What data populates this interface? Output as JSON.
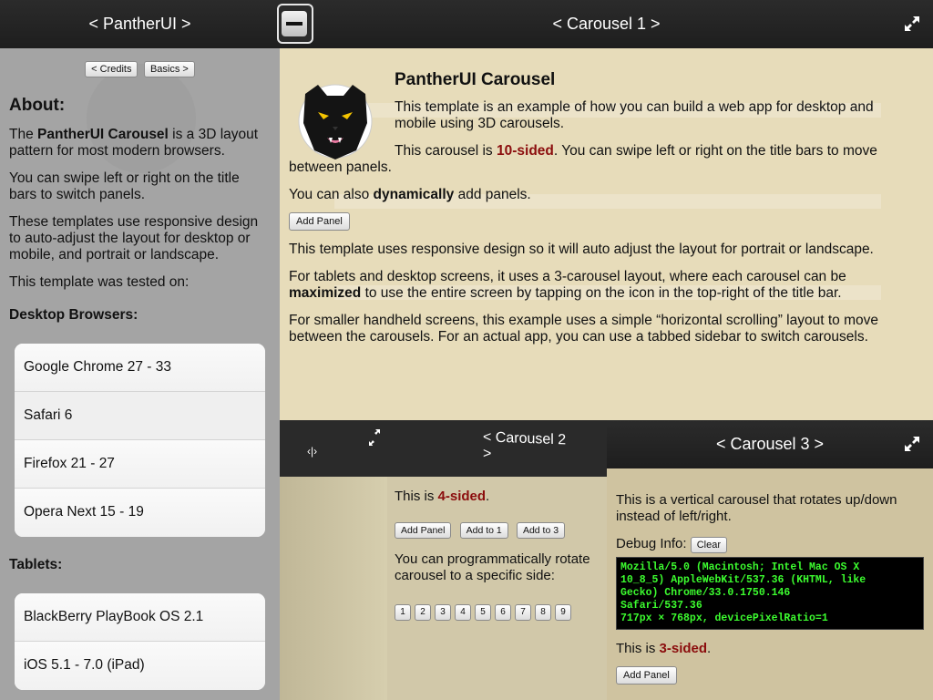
{
  "sidebar": {
    "title": "< PantherUI >",
    "credits_btn": "< Credits",
    "basics_btn": "Basics >",
    "about_heading": "About:",
    "about_p1_pre": "The ",
    "about_p1_bold": "PantherUI Carousel",
    "about_p1_post": " is a 3D layout pattern for most modern browsers.",
    "about_p2": "You can swipe left or right on the title bars to switch panels.",
    "about_p3": "These templates use responsive design to auto-adjust the layout for desktop or mobile, and portrait or landscape.",
    "about_p4": "This template was tested on:",
    "desktop_heading": "Desktop Browsers:",
    "desktop_items": [
      "Google Chrome 27 - 33",
      "Safari 6",
      "Firefox 21 - 27",
      "Opera Next 15 - 19"
    ],
    "tablets_heading": "Tablets:",
    "tablet_items": [
      "BlackBerry PlayBook OS 2.1",
      "iOS 5.1 - 7.0 (iPad)"
    ]
  },
  "carousel1": {
    "title": "< Carousel 1 >",
    "heading": "PantherUI Carousel",
    "p1": "This template is an example of how you can build a web app for desktop and mobile using 3D carousels.",
    "p2_pre": "This carousel is ",
    "p2_red": "10-sided",
    "p2_post": ". You can swipe left or right on the title bars to move between panels.",
    "p3_pre": "You can also ",
    "p3_bold": "dynamically",
    "p3_post": " add panels.",
    "add_panel": "Add Panel",
    "p4": "This template uses responsive design so it will auto adjust the layout for portrait or landscape.",
    "p5_pre": "For tablets and desktop screens, it uses a 3-carousel layout, where each carousel can be ",
    "p5_bold": "maximized",
    "p5_post": " to use the entire screen by tapping on the icon in the top-right of the title bar.",
    "p6": "For smaller handheld screens, this example uses a simple “horizontal scrolling” layout to move between the carousels. For an actual app, you can use a tabbed sidebar to switch carousels."
  },
  "carousel2": {
    "title": "< Carousel 2 >",
    "left_tab": "‹|›",
    "p1_pre": "This is ",
    "p1_red": "4-sided",
    "p1_post": ".",
    "add_panel": "Add Panel",
    "add_to_1": "Add to 1",
    "add_to_3": "Add to 3",
    "p2": "You can programmatically rotate carousel to a specific side:",
    "numbers": [
      "1",
      "2",
      "3",
      "4",
      "5",
      "6",
      "7",
      "8",
      "9"
    ]
  },
  "carousel3": {
    "title": "< Carousel 3 >",
    "p1": "This is a vertical carousel that rotates up/down instead of left/right.",
    "debug_label": "Debug Info:",
    "clear_btn": "Clear",
    "debug_text": "Mozilla/5.0 (Macintosh; Intel Mac OS X\n10_8_5) AppleWebKit/537.36 (KHTML, like\nGecko) Chrome/33.0.1750.146\nSafari/537.36\n717px × 768px, devicePixelRatio=1",
    "p2_pre": "This is ",
    "p2_red": "3-sided",
    "p2_post": ".",
    "add_panel": "Add Panel"
  },
  "colors": {
    "titlebar": "#2b2b2b",
    "panel": "#e7dcba",
    "accent_red": "#8b0d0d",
    "debug_green": "#3cfc2f"
  }
}
